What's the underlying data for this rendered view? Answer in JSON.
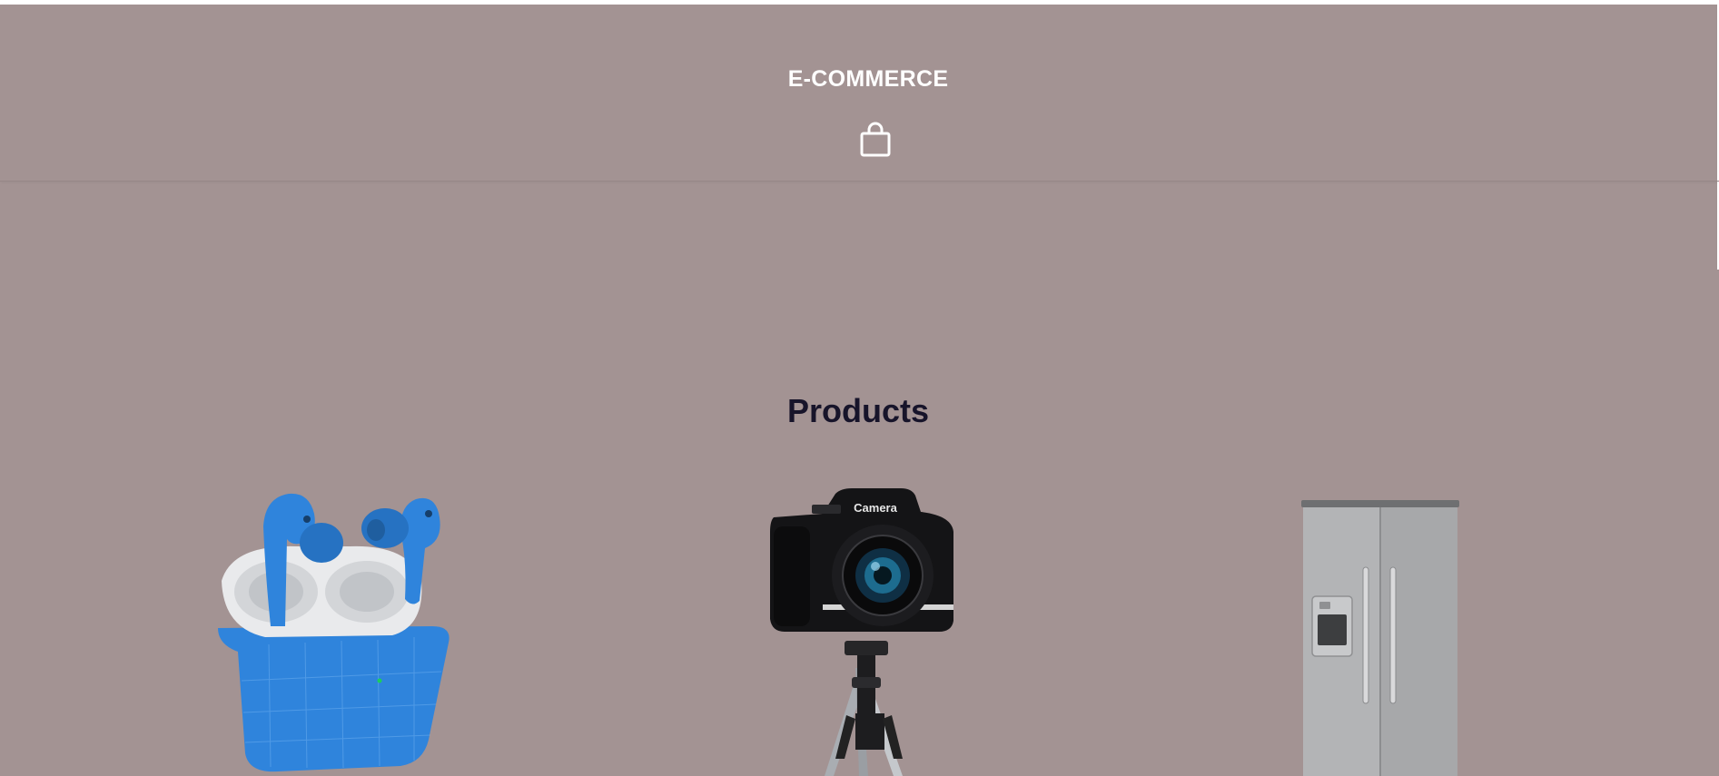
{
  "header": {
    "brand": "E-COMMERCE",
    "cart_icon": "shopping-bag-icon"
  },
  "products_section": {
    "title": "Products",
    "items": [
      {
        "image": "wireless-earbuds",
        "case_color": "#2f84dc"
      },
      {
        "image": "camera-on-tripod",
        "label": "Camera"
      },
      {
        "image": "refrigerator"
      }
    ]
  },
  "colors": {
    "background": "#a39393",
    "brand_text": "#ffffff",
    "title_text": "#17142a"
  }
}
